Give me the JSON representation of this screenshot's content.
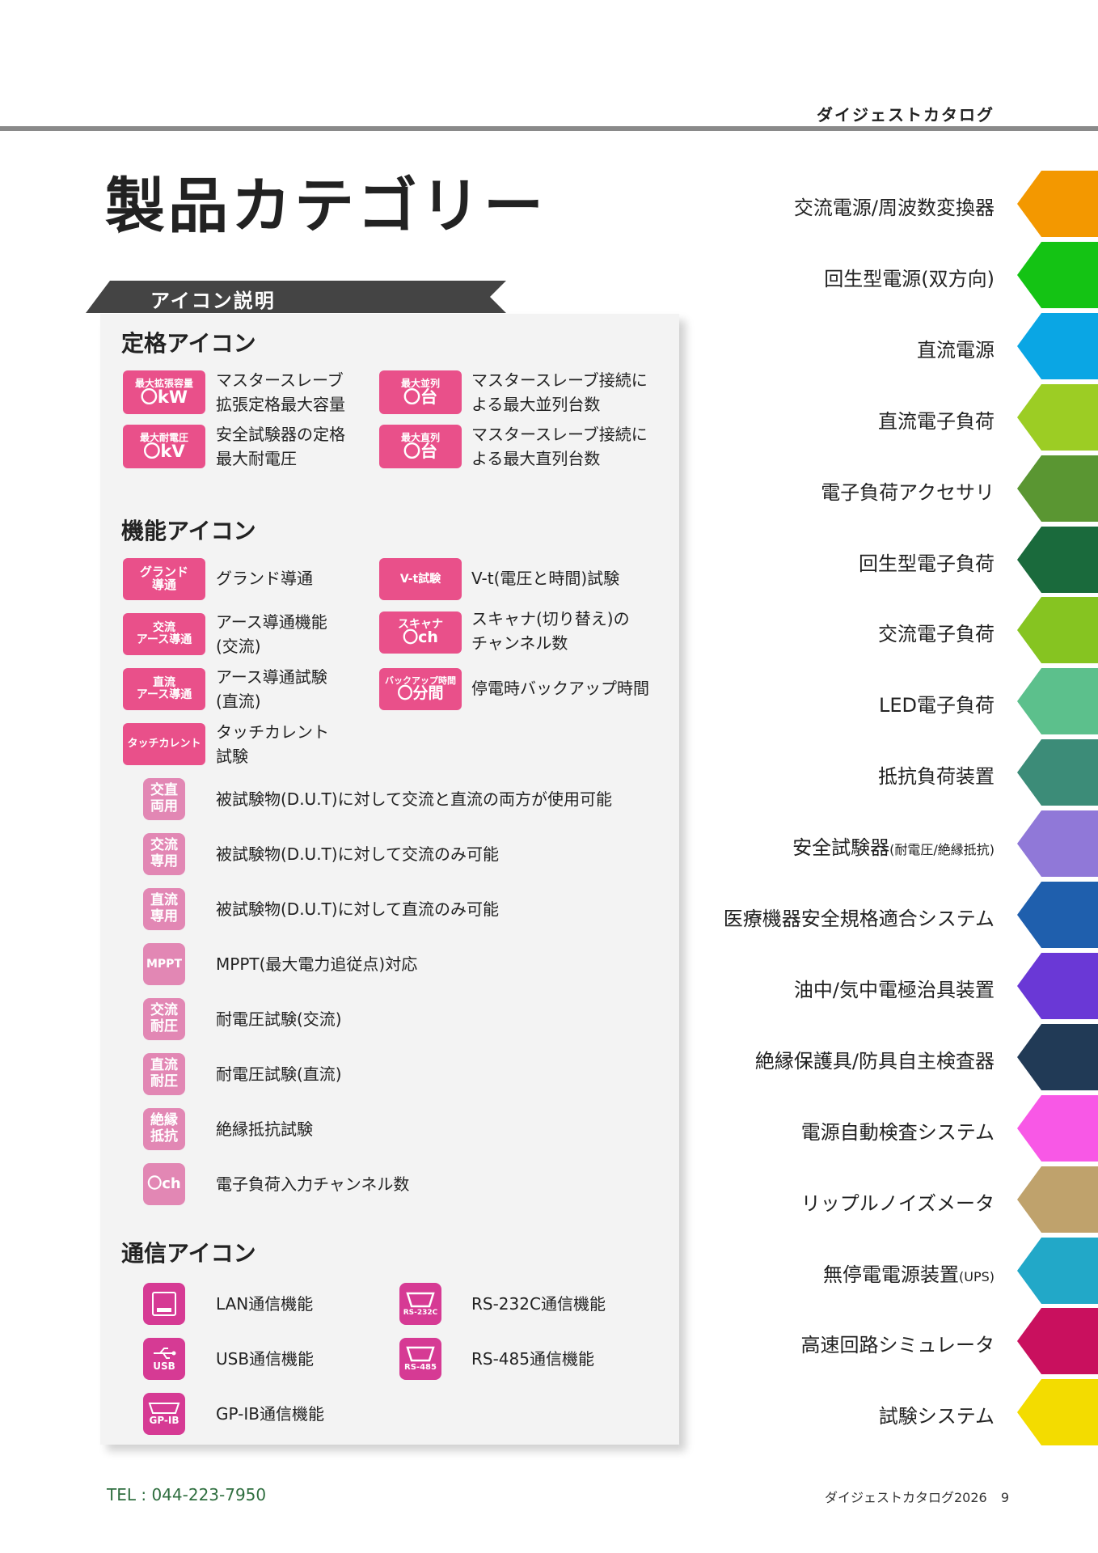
{
  "header": {
    "label": "ダイジェストカタログ"
  },
  "page_title": "製品カテゴリー",
  "panel": {
    "ribbon": "アイコン説明",
    "rating": {
      "heading": "定格アイコン",
      "items": [
        {
          "badge_top": "最大拡張容量",
          "badge_main": "〇kW",
          "desc1": "マスタースレーブ",
          "desc2": "拡張定格最大容量"
        },
        {
          "badge_top": "最大並列",
          "badge_main": "〇台",
          "desc1": "マスタースレーブ接続に",
          "desc2": "よる最大並列台数"
        },
        {
          "badge_top": "最大耐電圧",
          "badge_main": "〇kV",
          "desc1": "安全試験器の定格",
          "desc2": "最大耐電圧"
        },
        {
          "badge_top": "最大直列",
          "badge_main": "〇台",
          "desc1": "マスタースレーブ接続に",
          "desc2": "よる最大直列台数"
        }
      ]
    },
    "function": {
      "heading": "機能アイコン",
      "items": [
        {
          "badge1": "グランド",
          "badge2": "導通",
          "desc1": "グランド導通",
          "desc2": ""
        },
        {
          "badge1": "V-t試験",
          "badge2": "",
          "desc1": "V-t(電圧と時間)試験",
          "desc2": ""
        },
        {
          "badge1": "交流",
          "badge2": "アース導通",
          "desc1": "アース導通機能",
          "desc2": "(交流)"
        },
        {
          "badge1": "スキャナ",
          "badge2": "〇ch",
          "desc1": "スキャナ(切り替え)の",
          "desc2": "チャンネル数"
        },
        {
          "badge1": "直流",
          "badge2": "アース導通",
          "desc1": "アース導通試験",
          "desc2": "(直流)"
        },
        {
          "badge1": "バックアップ時間",
          "badge2": "〇分間",
          "desc1": "停電時バックアップ時間",
          "desc2": ""
        },
        {
          "badge1": "タッチカレント",
          "badge2": "",
          "desc1": "タッチカレント",
          "desc2": "試験"
        }
      ],
      "square_items": [
        {
          "l1": "交直",
          "l2": "両用",
          "desc": "被試験物(D.U.T)に対して交流と直流の両方が使用可能"
        },
        {
          "l1": "交流",
          "l2": "専用",
          "desc": "被試験物(D.U.T)に対して交流のみ可能"
        },
        {
          "l1": "直流",
          "l2": "専用",
          "desc": "被試験物(D.U.T)に対して直流のみ可能"
        },
        {
          "l1": "MPPT",
          "l2": "",
          "desc": "MPPT(最大電力追従点)対応"
        },
        {
          "l1": "交流",
          "l2": "耐圧",
          "desc": "耐電圧試験(交流)"
        },
        {
          "l1": "直流",
          "l2": "耐圧",
          "desc": "耐電圧試験(直流)"
        },
        {
          "l1": "絶縁",
          "l2": "抵抗",
          "desc": "絶縁抵抗試験"
        },
        {
          "l1": "〇ch",
          "l2": "",
          "desc": "電子負荷入力チャンネル数"
        }
      ]
    },
    "comm": {
      "heading": "通信アイコン",
      "items": [
        {
          "label": "LAN",
          "desc": "LAN通信機能"
        },
        {
          "label": "RS-232C",
          "desc": "RS-232C通信機能"
        },
        {
          "label": "USB",
          "desc": "USB通信機能"
        },
        {
          "label": "RS-485",
          "desc": "RS-485通信機能"
        },
        {
          "label": "GP-IB",
          "desc": "GP-IB通信機能"
        }
      ]
    }
  },
  "categories": [
    {
      "label": "交流電源/周波数変換器",
      "sub": "",
      "color": "#f39800"
    },
    {
      "label": "回生型電源(双方向)",
      "sub": "",
      "color": "#14c314"
    },
    {
      "label": "直流電源",
      "sub": "",
      "color": "#0aa6e4"
    },
    {
      "label": "直流電子負荷",
      "sub": "",
      "color": "#9ccd24"
    },
    {
      "label": "電子負荷アクセサリ",
      "sub": "",
      "color": "#5a9632"
    },
    {
      "label": "回生型電子負荷",
      "sub": "",
      "color": "#1a6a3c"
    },
    {
      "label": "交流電子負荷",
      "sub": "",
      "color": "#86c421"
    },
    {
      "label": "LED電子負荷",
      "sub": "",
      "color": "#5cc08c"
    },
    {
      "label": "抵抗負荷装置",
      "sub": "",
      "color": "#3c8c78"
    },
    {
      "label": "安全試験器",
      "sub": "(耐電圧/絶縁抵抗)",
      "color": "#9078d8"
    },
    {
      "label": "医療機器安全規格適合システム",
      "sub": "",
      "color": "#1f5fad"
    },
    {
      "label": "油中/気中電極治具装置",
      "sub": "",
      "color": "#6a38d6"
    },
    {
      "label": "絶縁保護具/防具自主検査器",
      "sub": "",
      "color": "#213a56"
    },
    {
      "label": "電源自動検査システム",
      "sub": "",
      "color": "#f858e6"
    },
    {
      "label": "リップルノイズメータ",
      "sub": "",
      "color": "#bfa26c"
    },
    {
      "label": "無停電電源装置",
      "sub": "(UPS)",
      "color": "#22a8c8"
    },
    {
      "label": "高速回路シミュレータ",
      "sub": "",
      "color": "#c9105e"
    },
    {
      "label": "試験システム",
      "sub": "",
      "color": "#f3dc00"
    }
  ],
  "footer": {
    "tel": "TEL : 044-223-7950",
    "catalog": "ダイジェストカタログ2026",
    "page": "9"
  }
}
